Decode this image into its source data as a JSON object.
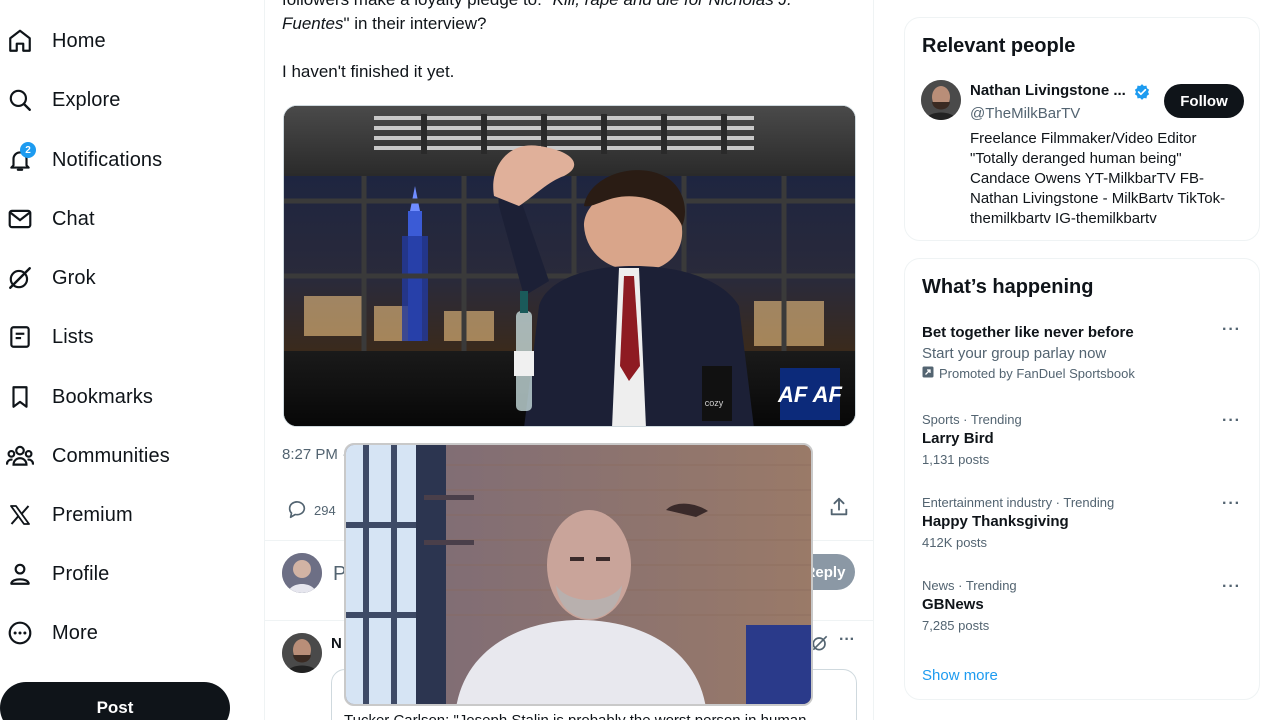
{
  "nav": {
    "items": [
      {
        "label": "Home",
        "icon": "home-icon"
      },
      {
        "label": "Explore",
        "icon": "search-icon"
      },
      {
        "label": "Notifications",
        "icon": "bell-icon",
        "badge": "2"
      },
      {
        "label": "Chat",
        "icon": "envelope-icon"
      },
      {
        "label": "Grok",
        "icon": "grok-icon"
      },
      {
        "label": "Lists",
        "icon": "list-icon"
      },
      {
        "label": "Bookmarks",
        "icon": "bookmark-icon"
      },
      {
        "label": "Communities",
        "icon": "communities-icon"
      },
      {
        "label": "Premium",
        "icon": "x-logo-icon"
      },
      {
        "label": "Profile",
        "icon": "person-icon"
      },
      {
        "label": "More",
        "icon": "more-circle-icon"
      }
    ],
    "post_label": "Post"
  },
  "tweet": {
    "text_line1_plain": "followers make a loyalty pledge to: \"",
    "text_line1_italic": "Kill, rape and die for Nicholas J.",
    "text_line2_italic": "Fuentes",
    "text_line2_plain": "\" in their interview?",
    "text_line3": "I haven't finished it yet.",
    "media_watermark": "AF AF",
    "media_logo": "cozy",
    "time": "8:27 PM · ",
    "replies": "294",
    "reply_placeholder": "P",
    "reply_button": "Reply"
  },
  "second_tweet": {
    "author_initial": "N",
    "quote_text": "Tucker Carlson: \"Joseph Stalin is probably the worst person in human"
  },
  "relevant_people": {
    "title": "Relevant people",
    "name": "Nathan Livingstone ...",
    "handle": "@TheMilkBarTV",
    "follow_label": "Follow",
    "bio_lines": [
      "Freelance Filmmaker/Video Editor",
      "\"Totally deranged human being\"",
      "Candace Owens YT-MilkbarTV FB-",
      "Nathan Livingstone - MilkBartv TikTok-",
      "themilkbartv IG-themilkbartv"
    ]
  },
  "whats_happening": {
    "title": "What’s happening",
    "promo": {
      "name": "Bet together like never before",
      "sub": "Start your group parlay now",
      "promoted": "Promoted by FanDuel Sportsbook"
    },
    "trends": [
      {
        "meta": "Sports · Trending",
        "name": "Larry Bird",
        "count": "1,131 posts"
      },
      {
        "meta": "Entertainment industry · Trending",
        "name": "Happy Thanksgiving",
        "count": "412K posts"
      },
      {
        "meta": "News · Trending",
        "name": "GBNews",
        "count": "7,285 posts"
      }
    ],
    "show_more": "Show more"
  },
  "colors": {
    "accent": "#1d9bf0",
    "text": "#0f1419",
    "muted": "#536471"
  }
}
